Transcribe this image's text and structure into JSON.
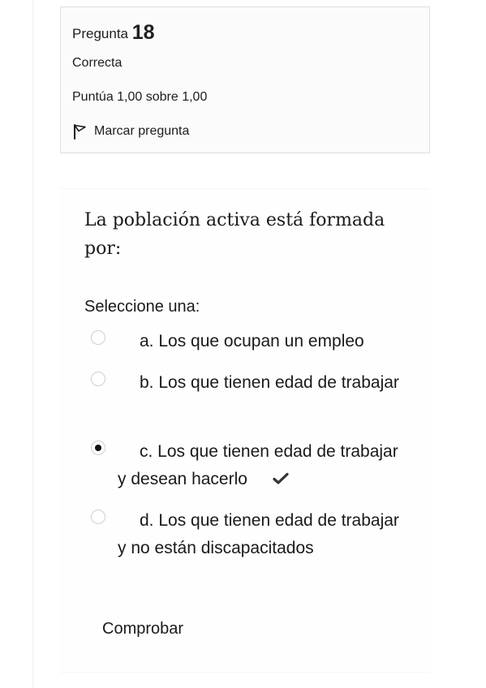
{
  "info": {
    "question_label": "Pregunta",
    "question_number": "18",
    "state": "Correcta",
    "grade": "Puntúa 1,00 sobre 1,00",
    "flag_label": "Marcar pregunta",
    "flag_icon": "flag-icon"
  },
  "question": {
    "text": "La población activa está formada por:",
    "prompt": "Seleccione una:",
    "answers": [
      {
        "label": "a. Los que ocupan un empleo",
        "selected": false
      },
      {
        "label": "b. Los que tienen edad de trabajar",
        "selected": false
      },
      {
        "label": "c. Los que tienen edad de trabajar y desean hacerlo",
        "selected": true,
        "correct": true
      },
      {
        "label": "d. Los que tienen edad de trabajar y no están discapacitados",
        "selected": false
      }
    ],
    "correct_icon": "checkmark-icon",
    "correct_color": "#333333"
  },
  "check_button_label": "Comprobar"
}
